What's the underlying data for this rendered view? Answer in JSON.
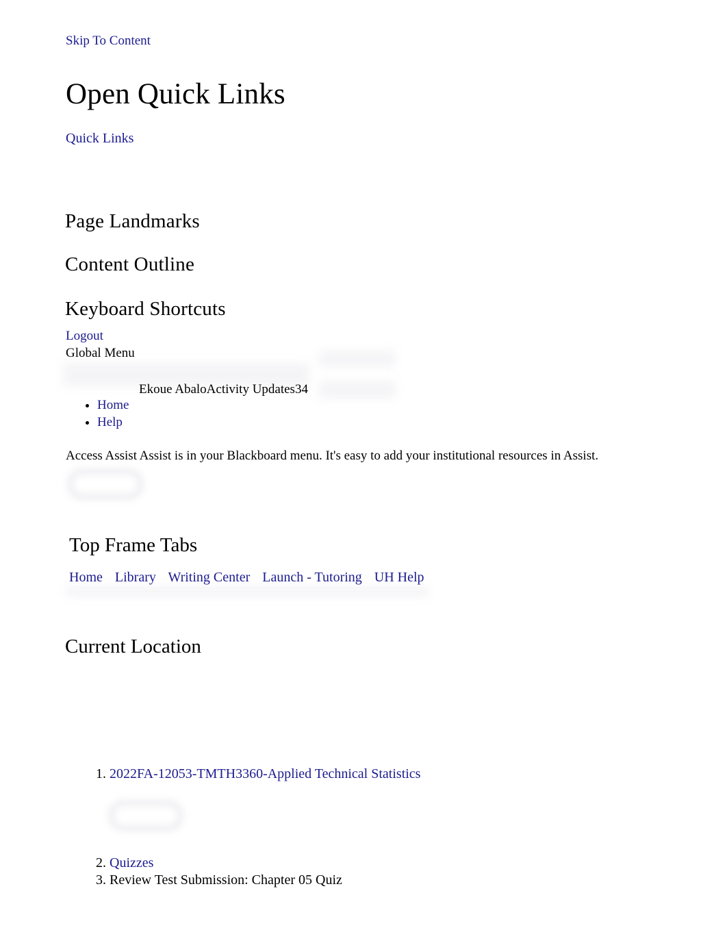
{
  "colors": {
    "link": "#1b1b8f",
    "text": "#000000",
    "background": "#ffffff",
    "ghost": "#ececf0"
  },
  "skip_link": {
    "label": "Skip To Content"
  },
  "page_title": "Open Quick Links",
  "quick_links_link": {
    "label": "Quick Links"
  },
  "landmarks": {
    "page_landmarks_heading": "Page Landmarks",
    "content_outline_heading": "Content Outline",
    "keyboard_shortcuts_heading": "Keyboard Shortcuts"
  },
  "account": {
    "logout_label": "Logout",
    "global_menu_label": "Global Menu",
    "user_activity_line": "Ekoue AbaloActivity Updates34",
    "user_name": "Ekoue Abalo",
    "activity_updates_label": "Activity Updates",
    "activity_updates_count": "34",
    "menu_items": [
      {
        "label": "Home"
      },
      {
        "label": "Help"
      }
    ]
  },
  "assist": {
    "text": "Access Assist Assist is in your Blackboard menu. It's easy to add your institutional resources in Assist."
  },
  "top_frame_tabs": {
    "heading": "Top Frame Tabs",
    "tabs": [
      {
        "label": "Home"
      },
      {
        "label": "Library"
      },
      {
        "label": "Writing Center"
      },
      {
        "label": "Launch - Tutoring"
      },
      {
        "label": "UH Help"
      }
    ]
  },
  "current_location": {
    "heading": "Current Location",
    "breadcrumb": [
      {
        "label": "2022FA-12053-TMTH3360-Applied Technical Statistics",
        "is_link": true
      },
      {
        "label": "Quizzes",
        "is_link": true
      },
      {
        "label": "Review Test Submission: Chapter 05 Quiz",
        "is_link": false
      }
    ]
  }
}
